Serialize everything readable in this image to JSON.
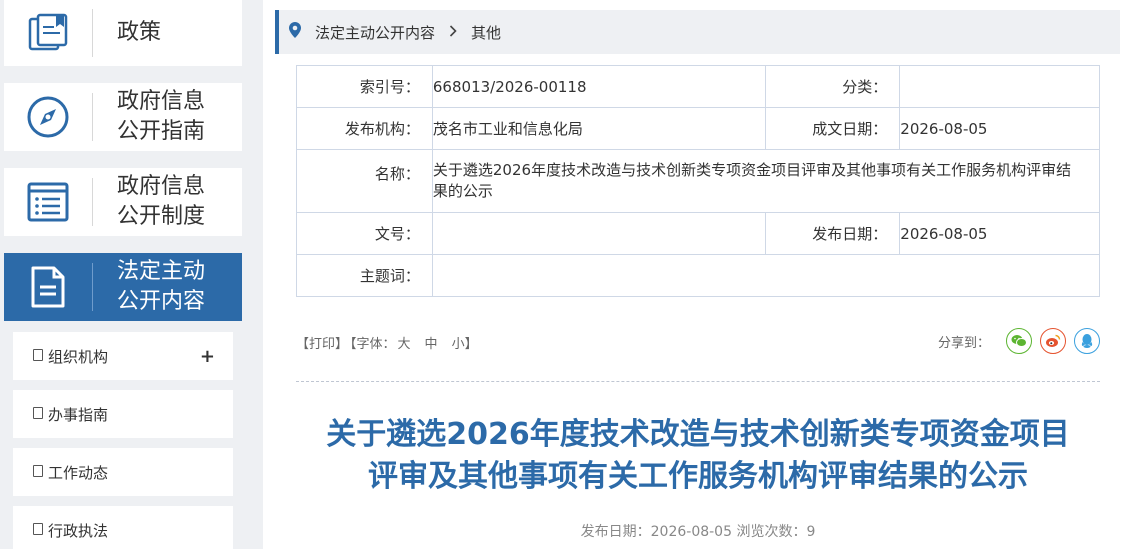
{
  "sidebar": {
    "nav": [
      {
        "label": "政策",
        "icon": "policy-book-icon"
      },
      {
        "label": "政府信息公开指南",
        "line1": "政府信息",
        "line2": "公开指南",
        "icon": "compass-icon"
      },
      {
        "label": "政府信息公开制度",
        "line1": "政府信息",
        "line2": "公开制度",
        "icon": "list-icon"
      },
      {
        "label": "法定主动公开内容",
        "line1": "法定主动",
        "line2": "公开内容",
        "icon": "document-icon"
      }
    ],
    "sub": [
      {
        "label": "组织机构",
        "expand": "+"
      },
      {
        "label": "办事指南"
      },
      {
        "label": "工作动态"
      },
      {
        "label": "行政执法"
      }
    ]
  },
  "breadcrumb": {
    "item1": "法定主动公开内容",
    "item2": "其他"
  },
  "meta": {
    "index_label": "索引号：",
    "index_value": "668013/2026-00118",
    "category_label": "分类：",
    "category_value": "",
    "publisher_label": "发布机构：",
    "publisher_value": "茂名市工业和信息化局",
    "created_label": "成文日期：",
    "created_value": "2026-08-05",
    "name_label": "名称：",
    "name_value": "关于遴选2026年度技术改造与技术创新类专项资金项目评审及其他事项有关工作服务机构评审结果的公示",
    "docno_label": "文号：",
    "docno_value": "",
    "pubdate_label": "发布日期：",
    "pubdate_value": "2026-08-05",
    "keywords_label": "主题词：",
    "keywords_value": ""
  },
  "tools": {
    "print": "【打印】",
    "font_open": "【字体：",
    "big": "大",
    "mid": "中",
    "small": "小",
    "font_close": "】",
    "share": "分享到："
  },
  "article": {
    "title_line1": "关于遴选2026年度技术改造与技术创新类专项资金项目",
    "title_line2": "评审及其他事项有关工作服务机构评审结果的公示",
    "pubinfo": "发布日期：2026-08-05  浏览次数：9"
  },
  "colors": {
    "accent": "#2c6aa8",
    "wechat": "#5cb531",
    "weibo": "#e5532f",
    "qq": "#3aa0de"
  }
}
